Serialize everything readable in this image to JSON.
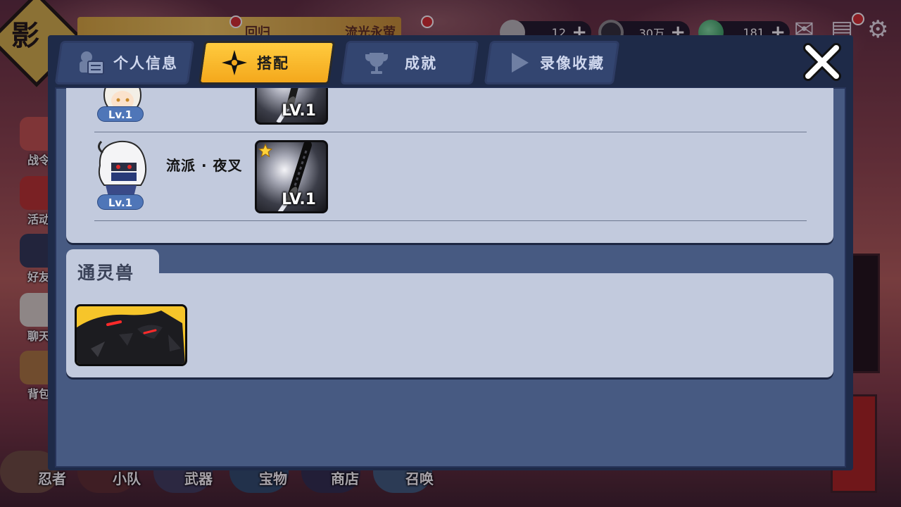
{
  "background": {
    "logo_char": "影",
    "banner_texts": [
      "回归",
      "流光永萤"
    ],
    "resources": [
      {
        "icon": "crystal-icon",
        "value": "12"
      },
      {
        "icon": "coin-icon",
        "value": "30万"
      },
      {
        "icon": "jade-orb-icon",
        "value": "181"
      }
    ],
    "side_menu": [
      {
        "icon": "battle-pass-icon",
        "label": "战令"
      },
      {
        "icon": "torii-gate-icon",
        "label": "活动"
      },
      {
        "icon": "ninja-friend-icon",
        "label": "好友"
      },
      {
        "icon": "chat-bubble-icon",
        "label": "聊天"
      },
      {
        "icon": "backpack-icon",
        "label": "背包"
      }
    ],
    "bottom_menu": [
      {
        "icon": "ninja-avatar-icon",
        "label": "忍者"
      },
      {
        "icon": "squad-icon",
        "label": "小队"
      },
      {
        "icon": "weapon-icon",
        "label": "武器"
      },
      {
        "icon": "treasure-icon",
        "label": "宝物"
      },
      {
        "icon": "shop-icon",
        "label": "商店"
      },
      {
        "icon": "summon-icon",
        "label": "召唤"
      }
    ]
  },
  "modal": {
    "tabs": [
      {
        "id": "profile",
        "icon": "id-card-icon",
        "label": "个人信息",
        "active": false
      },
      {
        "id": "loadout",
        "icon": "shuriken-icon",
        "label": "搭配",
        "active": true
      },
      {
        "id": "achievements",
        "icon": "trophy-icon",
        "label": "成就",
        "active": false
      },
      {
        "id": "replays",
        "icon": "play-icon",
        "label": "录像收藏",
        "active": false
      }
    ],
    "close_icon": "close-icon"
  },
  "loadout": {
    "rows": [
      {
        "avatar": "white-haired-ninja-avatar",
        "level": "Lv.1",
        "school": "",
        "weapon": {
          "icon": "katana-icon",
          "level": "LV.1",
          "starred": false
        }
      },
      {
        "avatar": "masked-white-haired-ninja-avatar",
        "level": "Lv.1",
        "school": "流派 · 夜叉",
        "weapon": {
          "icon": "dark-katana-icon",
          "level": "LV.1",
          "starred": true
        }
      }
    ],
    "spirit_beast": {
      "title": "通灵兽",
      "items": [
        {
          "icon": "black-dragon-icon"
        }
      ]
    }
  },
  "colors": {
    "active_tab": "#f4a81c",
    "panel_bg": "#c2cadd",
    "modal_bg": "#475a82",
    "level_badge": "#4f76b8"
  }
}
